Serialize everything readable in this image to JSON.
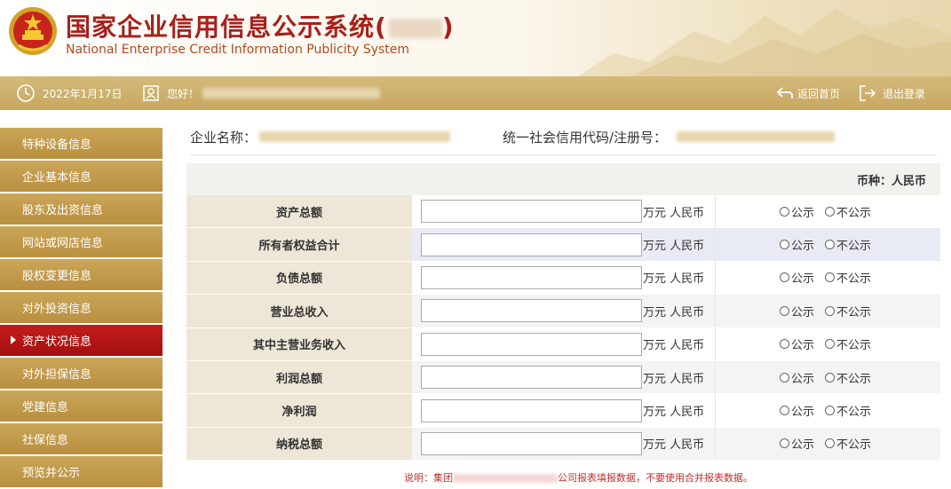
{
  "header": {
    "title": "国家企业信用信息公示系统(",
    "title_end": ")",
    "subtitle": "National Enterprise Credit Information Publicity System"
  },
  "topbar": {
    "date": "2022年1月17日",
    "greeting": "您好！",
    "home_label": "返回首页",
    "logout_label": "退出登录"
  },
  "sidebar": {
    "items": [
      {
        "label": "特种设备信息"
      },
      {
        "label": "企业基本信息"
      },
      {
        "label": "股东及出资信息"
      },
      {
        "label": "网站或网店信息"
      },
      {
        "label": "股权变更信息"
      },
      {
        "label": "对外投资信息"
      },
      {
        "label": "资产状况信息",
        "active": true
      },
      {
        "label": "对外担保信息"
      },
      {
        "label": "党建信息"
      },
      {
        "label": "社保信息"
      },
      {
        "label": "预览并公示"
      }
    ]
  },
  "info": {
    "company_label": "企业名称：",
    "code_label": "统一社会信用代码/注册号："
  },
  "form": {
    "currency": "币种：人民币",
    "unit": "万元 人民币",
    "public_label": "公示",
    "private_label": "不公示",
    "rows": [
      {
        "label": "资产总额",
        "value": ""
      },
      {
        "label": "所有者权益合计",
        "value": ""
      },
      {
        "label": "负债总额",
        "value": ""
      },
      {
        "label": "营业总收入",
        "value": ""
      },
      {
        "label": "其中主营业务收入",
        "value": ""
      },
      {
        "label": "利润总额",
        "value": ""
      },
      {
        "label": "净利润",
        "value": ""
      },
      {
        "label": "纳税总额",
        "value": ""
      }
    ]
  },
  "note": {
    "prefix": "说明：集团",
    "middle": "公司报表填报数据，不要使用合并报表数据。"
  },
  "colors": {
    "title": "#a8201a",
    "topbar": "#c7a862",
    "sidebar_item": "#b98f3f",
    "sidebar_active": "#a40f10",
    "note": "#c0302a"
  }
}
